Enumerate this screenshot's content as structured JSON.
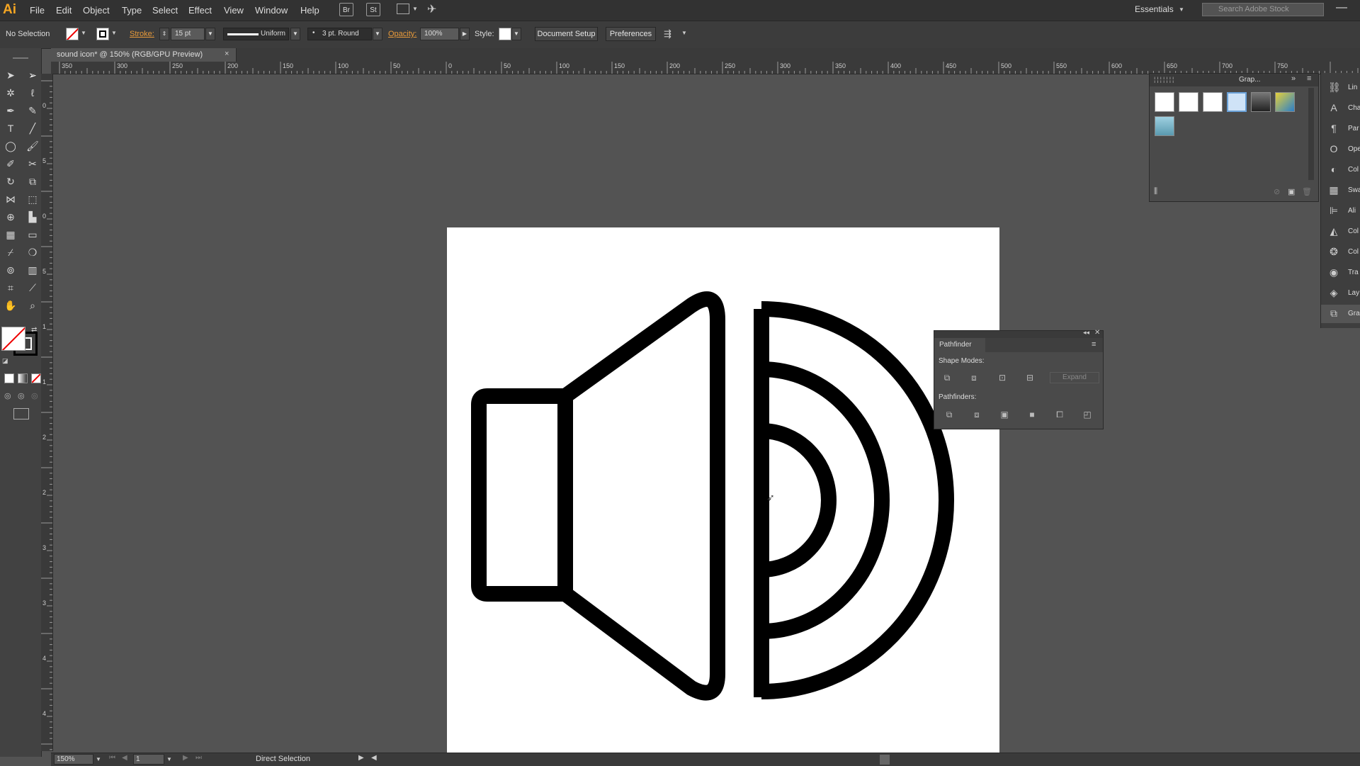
{
  "app": {
    "logo": "Ai"
  },
  "menu": [
    "File",
    "Edit",
    "Object",
    "Type",
    "Select",
    "Effect",
    "View",
    "Window",
    "Help"
  ],
  "menubar_icons": {
    "bridge": "Br",
    "stock": "St"
  },
  "workspace": "Essentials",
  "search": {
    "placeholder": "Search Adobe Stock"
  },
  "control_bar": {
    "selection_label": "No Selection",
    "stroke_label": "Stroke:",
    "stroke_weight": "15 pt",
    "profile": "Uniform",
    "brush": "3 pt. Round",
    "opacity_label": "Opacity:",
    "opacity_value": "100%",
    "style_label": "Style:",
    "document_setup": "Document Setup",
    "preferences": "Preferences"
  },
  "document_tab": {
    "title": "sound icon* @ 150% (RGB/GPU Preview)",
    "close": "×"
  },
  "ruler_h_labels": [
    "350",
    "300",
    "250",
    "200",
    "150",
    "100",
    "50",
    "0",
    "50",
    "100",
    "150",
    "200",
    "250",
    "300",
    "350",
    "400",
    "450",
    "500",
    "550",
    "600",
    "650",
    "700",
    "750"
  ],
  "ruler_v_labels": [
    "0",
    "5",
    "0",
    "5",
    "1",
    "1",
    "2",
    "2",
    "3",
    "3",
    "4",
    "4"
  ],
  "dock": [
    {
      "icon": "link-icon",
      "glyph": "⛓",
      "label": "Lin"
    },
    {
      "icon": "character-icon",
      "glyph": "A",
      "label": "Cha"
    },
    {
      "icon": "paragraph-icon",
      "glyph": "¶",
      "label": "Par"
    },
    {
      "icon": "opentype-icon",
      "glyph": "O",
      "label": "Ope"
    },
    {
      "icon": "color-guide-icon",
      "glyph": "◐",
      "label": "Col"
    },
    {
      "icon": "swatches-icon",
      "glyph": "▦",
      "label": "Swa"
    },
    {
      "icon": "align-icon",
      "glyph": "⊫",
      "label": "Ali"
    },
    {
      "icon": "color-icon",
      "glyph": "◭",
      "label": "Col"
    },
    {
      "icon": "color-themes-icon",
      "glyph": "❂",
      "label": "Col"
    },
    {
      "icon": "transparency-icon",
      "glyph": "◉",
      "label": "Tra"
    },
    {
      "icon": "layers-icon",
      "glyph": "◈",
      "label": "Lay"
    },
    {
      "icon": "graphic-styles-icon",
      "glyph": "⧉",
      "label": "Gra"
    }
  ],
  "graphic_styles_panel": {
    "tab": "Grap..."
  },
  "pathfinder": {
    "title": "Pathfinder",
    "shape_modes": "Shape Modes:",
    "expand": "Expand",
    "pathfinders": "Pathfinders:"
  },
  "status": {
    "zoom": "150%",
    "artboard": "1",
    "tool": "Direct Selection"
  },
  "colors": {
    "accent_orange": "#e89a3a",
    "canvas": "#535353",
    "panel": "#4a4a4a"
  }
}
